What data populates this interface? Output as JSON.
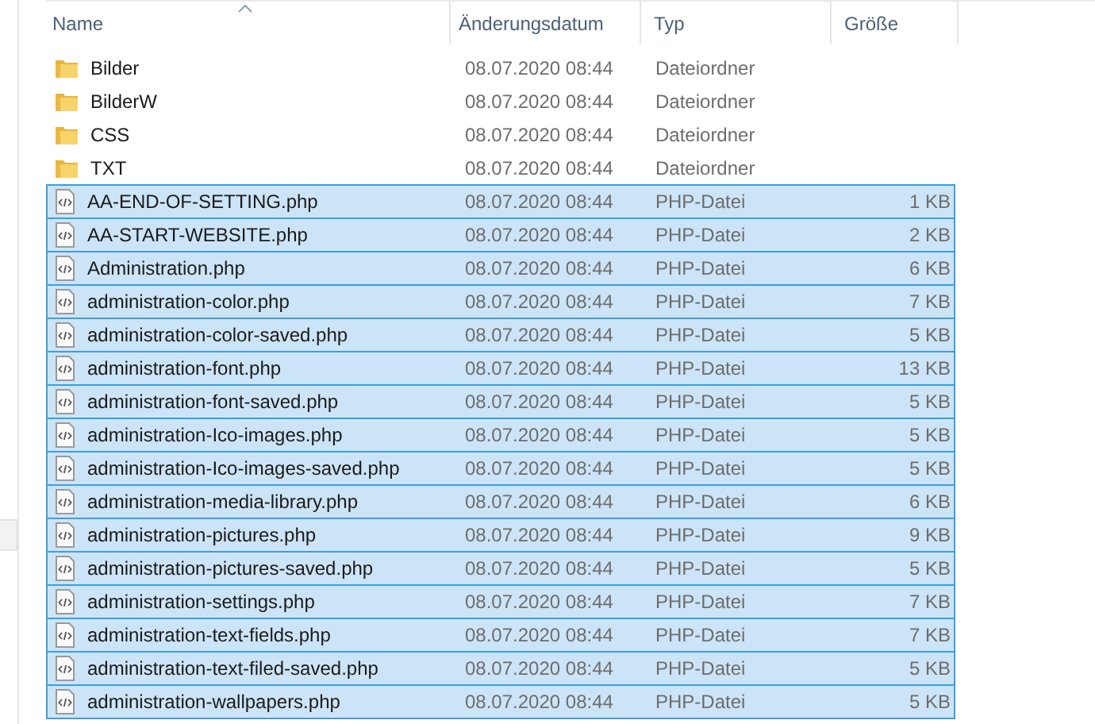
{
  "columns": [
    {
      "label": "Name",
      "sorted": true
    },
    {
      "label": "Änderungsdatum",
      "sorted": false
    },
    {
      "label": "Typ",
      "sorted": false
    },
    {
      "label": "Größe",
      "sorted": false
    }
  ],
  "rows": [
    {
      "kind": "folder",
      "name": "Bilder",
      "date": "08.07.2020 08:44",
      "type": "Dateiordner",
      "selected": false
    },
    {
      "kind": "folder",
      "name": "BilderW",
      "date": "08.07.2020 08:44",
      "type": "Dateiordner",
      "selected": false
    },
    {
      "kind": "folder",
      "name": "CSS",
      "date": "08.07.2020 08:44",
      "type": "Dateiordner",
      "selected": false
    },
    {
      "kind": "folder",
      "name": "TXT",
      "date": "08.07.2020 08:44",
      "type": "Dateiordner",
      "selected": false
    },
    {
      "kind": "php",
      "name": "AA-END-OF-SETTING.php",
      "date": "08.07.2020 08:44",
      "type": "PHP-Datei",
      "size": "1 KB",
      "selected": true
    },
    {
      "kind": "php",
      "name": "AA-START-WEBSITE.php",
      "date": "08.07.2020 08:44",
      "type": "PHP-Datei",
      "size": "2 KB",
      "selected": true
    },
    {
      "kind": "php",
      "name": "Administration.php",
      "date": "08.07.2020 08:44",
      "type": "PHP-Datei",
      "size": "6 KB",
      "selected": true
    },
    {
      "kind": "php",
      "name": "administration-color.php",
      "date": "08.07.2020 08:44",
      "type": "PHP-Datei",
      "size": "7 KB",
      "selected": true
    },
    {
      "kind": "php",
      "name": "administration-color-saved.php",
      "date": "08.07.2020 08:44",
      "type": "PHP-Datei",
      "size": "5 KB",
      "selected": true
    },
    {
      "kind": "php",
      "name": "administration-font.php",
      "date": "08.07.2020 08:44",
      "type": "PHP-Datei",
      "size": "13 KB",
      "selected": true
    },
    {
      "kind": "php",
      "name": "administration-font-saved.php",
      "date": "08.07.2020 08:44",
      "type": "PHP-Datei",
      "size": "5 KB",
      "selected": true
    },
    {
      "kind": "php",
      "name": "administration-Ico-images.php",
      "date": "08.07.2020 08:44",
      "type": "PHP-Datei",
      "size": "5 KB",
      "selected": true
    },
    {
      "kind": "php",
      "name": "administration-Ico-images-saved.php",
      "date": "08.07.2020 08:44",
      "type": "PHP-Datei",
      "size": "5 KB",
      "selected": true
    },
    {
      "kind": "php",
      "name": "administration-media-library.php",
      "date": "08.07.2020 08:44",
      "type": "PHP-Datei",
      "size": "6 KB",
      "selected": true
    },
    {
      "kind": "php",
      "name": "administration-pictures.php",
      "date": "08.07.2020 08:44",
      "type": "PHP-Datei",
      "size": "9 KB",
      "selected": true
    },
    {
      "kind": "php",
      "name": "administration-pictures-saved.php",
      "date": "08.07.2020 08:44",
      "type": "PHP-Datei",
      "size": "5 KB",
      "selected": true
    },
    {
      "kind": "php",
      "name": "administration-settings.php",
      "date": "08.07.2020 08:44",
      "type": "PHP-Datei",
      "size": "7 KB",
      "selected": true
    },
    {
      "kind": "php",
      "name": "administration-text-fields.php",
      "date": "08.07.2020 08:44",
      "type": "PHP-Datei",
      "size": "7 KB",
      "selected": true
    },
    {
      "kind": "php",
      "name": "administration-text-filed-saved.php",
      "date": "08.07.2020 08:44",
      "type": "PHP-Datei",
      "size": "5 KB",
      "selected": true
    },
    {
      "kind": "php",
      "name": "administration-wallpapers.php",
      "date": "08.07.2020 08:44",
      "type": "PHP-Datei",
      "size": "5 KB",
      "selected": true
    }
  ]
}
